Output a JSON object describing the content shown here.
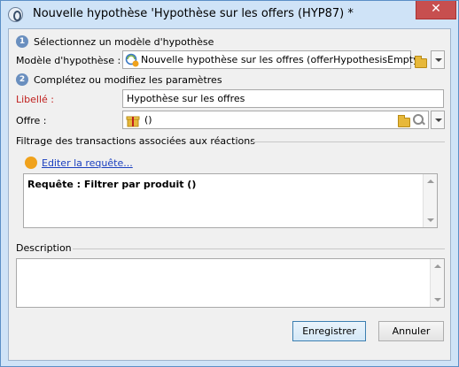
{
  "window": {
    "title": "Nouvelle hypothèse 'Hypothèse sur les offers (HYP87) *",
    "close_label": "✕"
  },
  "steps": {
    "step1": {
      "number": "1",
      "label": "Sélectionnez un modèle d'hypothèse"
    },
    "step2": {
      "number": "2",
      "label": "Complétez ou modifiez les paramètres"
    }
  },
  "model": {
    "label": "Modèle d'hypothèse :",
    "value": "Nouvelle hypothèse sur les offres (offerHypothesisEmpty)"
  },
  "libelle": {
    "label": "Libellé :",
    "value": "Hypothèse sur les offres"
  },
  "offre": {
    "label": "Offre :",
    "value": "()"
  },
  "filter": {
    "title": "Filtrage des transactions associées aux réactions",
    "edit_link": "Editer la requête...",
    "query_text": "Requête : Filtrer par produit ()"
  },
  "description": {
    "title": "Description",
    "value": ""
  },
  "buttons": {
    "save_label": "Enregistrer",
    "cancel_label": "Annuler"
  },
  "colors": {
    "title_bg": "#cfe3f7",
    "close_bg": "#c74f4f",
    "required_label": "#c0201e",
    "link": "#1a3fbf",
    "step_badge": "#6a8fbf"
  }
}
